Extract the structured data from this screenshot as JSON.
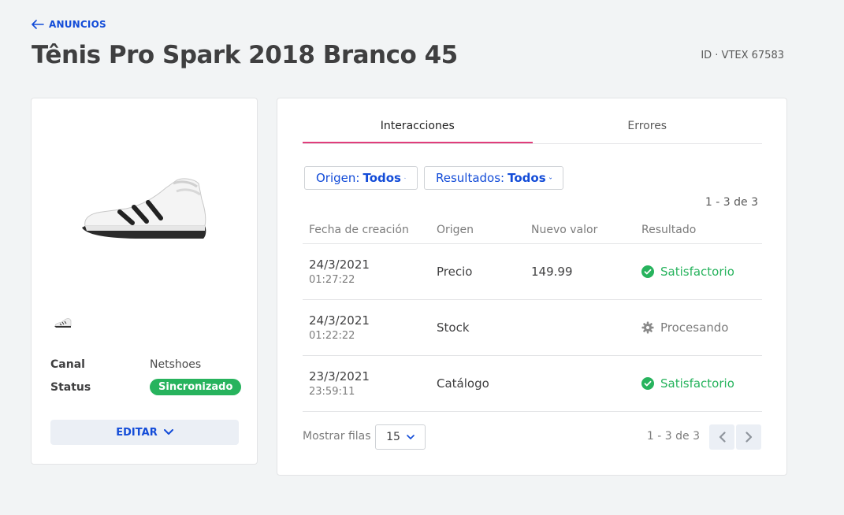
{
  "header": {
    "back_label": "ANUNCIOS",
    "title": "Tênis Pro Spark 2018 Branco 45",
    "id_label": "ID · VTEX 67583"
  },
  "product": {
    "image_icon": "sneaker-image",
    "thumb_icon": "sneaker-thumbnail",
    "canal_label": "Canal",
    "canal_value": "Netshoes",
    "status_label": "Status",
    "status_value": "Sincronizado",
    "edit_label": "EDITAR"
  },
  "tabs": [
    {
      "label": "Interacciones",
      "active": true
    },
    {
      "label": "Errores",
      "active": false
    }
  ],
  "filters": {
    "origen_label": "Origen:",
    "origen_value": "Todos",
    "resultados_label": "Resultados:",
    "resultados_value": "Todos"
  },
  "count_top": "1 - 3 de 3",
  "table": {
    "headers": [
      "Fecha de creación",
      "Origen",
      "Nuevo valor",
      "Resultado"
    ],
    "rows": [
      {
        "date": "24/3/2021",
        "time": "01:27:22",
        "origen": "Precio",
        "nuevo_valor": "149.99",
        "resultado": "Satisfactorio",
        "status": "success"
      },
      {
        "date": "24/3/2021",
        "time": "01:22:22",
        "origen": "Stock",
        "nuevo_valor": "",
        "resultado": "Procesando",
        "status": "processing"
      },
      {
        "date": "23/3/2021",
        "time": "23:59:11",
        "origen": "Catálogo",
        "nuevo_valor": "",
        "resultado": "Satisfactorio",
        "status": "success"
      }
    ]
  },
  "pagination": {
    "rows_label": "Mostrar filas",
    "rows_value": "15",
    "count": "1 - 3 de 3"
  },
  "colors": {
    "accent": "#134cd8",
    "success": "#27b35d",
    "tab_underline": "#e13d7b"
  }
}
